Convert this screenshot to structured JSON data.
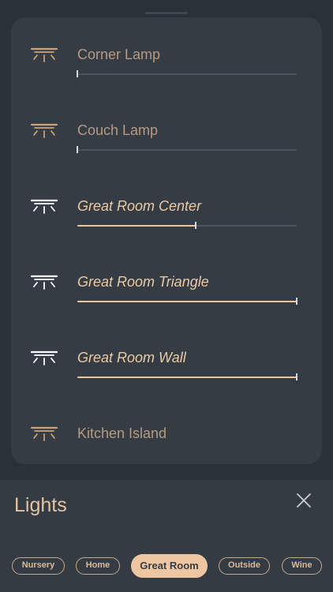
{
  "lights": [
    {
      "name": "Corner Lamp",
      "on": false,
      "brightness": 0
    },
    {
      "name": "Couch Lamp",
      "on": false,
      "brightness": 0
    },
    {
      "name": "Great Room Center",
      "on": true,
      "brightness": 0.54
    },
    {
      "name": "Great Room Triangle",
      "on": true,
      "brightness": 1.0
    },
    {
      "name": "Great Room Wall",
      "on": true,
      "brightness": 1.0
    },
    {
      "name": "Kitchen Island",
      "on": false,
      "brightness": 0
    }
  ],
  "panel": {
    "title": "Lights",
    "close_icon": "close-icon"
  },
  "rooms": [
    {
      "label": "Nursery",
      "active": false
    },
    {
      "label": "Home",
      "active": false
    },
    {
      "label": "Great Room",
      "active": true
    },
    {
      "label": "Outside",
      "active": false
    },
    {
      "label": "Wine",
      "active": false
    }
  ],
  "colors": {
    "accent": "#ebc9a5",
    "icon_off": "#c9a27c",
    "icon_on": "#ffffff",
    "track": "#4a5560",
    "background": "#2b3138",
    "card": "#353c44"
  }
}
